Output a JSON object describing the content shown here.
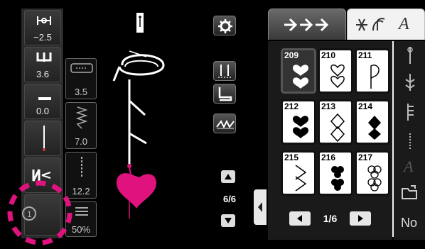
{
  "left_settings": {
    "width_value": "−2.5",
    "length_value": "3.6",
    "tension_value": "0.0"
  },
  "settings_boxes": {
    "upper_value": "3.5",
    "middle_value": "7.0",
    "lower_value": "12.2",
    "scale_value": "50%"
  },
  "preview": {
    "page_indicator": "6/6"
  },
  "tabs": {
    "utility_label": "",
    "decorative_label": "A"
  },
  "stitches": [
    {
      "num": "209"
    },
    {
      "num": "210"
    },
    {
      "num": "211"
    },
    {
      "num": "212"
    },
    {
      "num": "213"
    },
    {
      "num": "214"
    },
    {
      "num": "215"
    },
    {
      "num": "216"
    },
    {
      "num": "217"
    }
  ],
  "pager": {
    "text": "1/6"
  },
  "sidebar": {
    "font_label": "A",
    "no_label": "No"
  },
  "colors": {
    "accent": "#e0137e",
    "panel": "#f2f2f2"
  }
}
